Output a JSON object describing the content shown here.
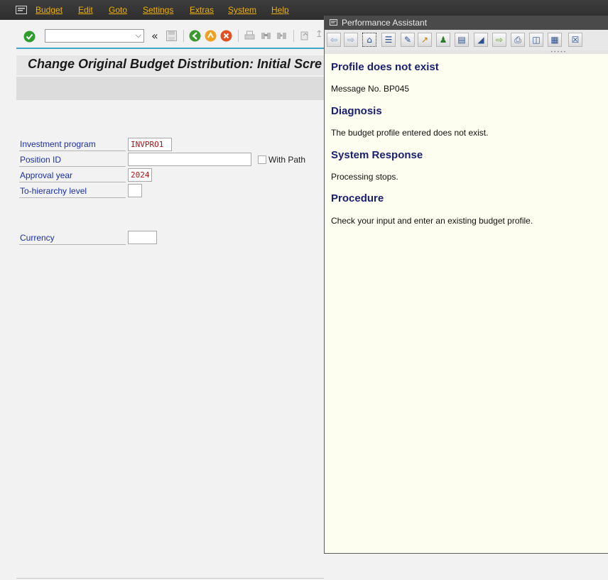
{
  "menu": {
    "items": [
      "Budget",
      "Edit",
      "Goto",
      "Settings",
      "Extras",
      "System",
      "Help"
    ]
  },
  "toolbar": {
    "command_field_value": ""
  },
  "header": {
    "title": "Change Original Budget Distribution: Initial Scre"
  },
  "form": {
    "investment_program": {
      "label": "Investment program",
      "value": "INVPRO1"
    },
    "position_id": {
      "label": "Position ID",
      "value": ""
    },
    "with_path": {
      "label": "With Path",
      "checked": false
    },
    "approval_year": {
      "label": "Approval year",
      "value": "2024"
    },
    "to_hierarchy_level": {
      "label": "To-hierarchy level",
      "value": ""
    },
    "currency": {
      "label": "Currency",
      "value": ""
    }
  },
  "performance_assistant": {
    "title": "Performance Assistant",
    "heading": "Profile  does not exist",
    "message_no": "Message No. BP045",
    "diagnosis_heading": "Diagnosis",
    "diagnosis_text": "The budget profile entered does not exist.",
    "system_response_heading": "System Response",
    "system_response_text": "Processing stops.",
    "procedure_heading": "Procedure",
    "procedure_text": "Check your input and enter an existing budget profile."
  },
  "colors": {
    "menu_text": "#f0b000",
    "label_text": "#1a2fa8",
    "value_text": "#b01010",
    "pa_heading": "#1a2070",
    "pa_background": "#fefef0"
  }
}
